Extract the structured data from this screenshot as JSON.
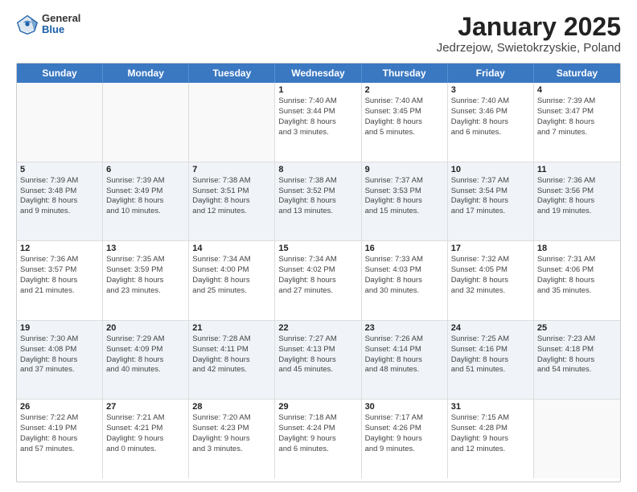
{
  "header": {
    "logo_general": "General",
    "logo_blue": "Blue",
    "title": "January 2025",
    "subtitle": "Jedrzejow, Swietokrzyskie, Poland"
  },
  "weekdays": [
    "Sunday",
    "Monday",
    "Tuesday",
    "Wednesday",
    "Thursday",
    "Friday",
    "Saturday"
  ],
  "rows": [
    {
      "alt": false,
      "cells": [
        {
          "day": "",
          "lines": []
        },
        {
          "day": "",
          "lines": []
        },
        {
          "day": "",
          "lines": []
        },
        {
          "day": "1",
          "lines": [
            "Sunrise: 7:40 AM",
            "Sunset: 3:44 PM",
            "Daylight: 8 hours",
            "and 3 minutes."
          ]
        },
        {
          "day": "2",
          "lines": [
            "Sunrise: 7:40 AM",
            "Sunset: 3:45 PM",
            "Daylight: 8 hours",
            "and 5 minutes."
          ]
        },
        {
          "day": "3",
          "lines": [
            "Sunrise: 7:40 AM",
            "Sunset: 3:46 PM",
            "Daylight: 8 hours",
            "and 6 minutes."
          ]
        },
        {
          "day": "4",
          "lines": [
            "Sunrise: 7:39 AM",
            "Sunset: 3:47 PM",
            "Daylight: 8 hours",
            "and 7 minutes."
          ]
        }
      ]
    },
    {
      "alt": true,
      "cells": [
        {
          "day": "5",
          "lines": [
            "Sunrise: 7:39 AM",
            "Sunset: 3:48 PM",
            "Daylight: 8 hours",
            "and 9 minutes."
          ]
        },
        {
          "day": "6",
          "lines": [
            "Sunrise: 7:39 AM",
            "Sunset: 3:49 PM",
            "Daylight: 8 hours",
            "and 10 minutes."
          ]
        },
        {
          "day": "7",
          "lines": [
            "Sunrise: 7:38 AM",
            "Sunset: 3:51 PM",
            "Daylight: 8 hours",
            "and 12 minutes."
          ]
        },
        {
          "day": "8",
          "lines": [
            "Sunrise: 7:38 AM",
            "Sunset: 3:52 PM",
            "Daylight: 8 hours",
            "and 13 minutes."
          ]
        },
        {
          "day": "9",
          "lines": [
            "Sunrise: 7:37 AM",
            "Sunset: 3:53 PM",
            "Daylight: 8 hours",
            "and 15 minutes."
          ]
        },
        {
          "day": "10",
          "lines": [
            "Sunrise: 7:37 AM",
            "Sunset: 3:54 PM",
            "Daylight: 8 hours",
            "and 17 minutes."
          ]
        },
        {
          "day": "11",
          "lines": [
            "Sunrise: 7:36 AM",
            "Sunset: 3:56 PM",
            "Daylight: 8 hours",
            "and 19 minutes."
          ]
        }
      ]
    },
    {
      "alt": false,
      "cells": [
        {
          "day": "12",
          "lines": [
            "Sunrise: 7:36 AM",
            "Sunset: 3:57 PM",
            "Daylight: 8 hours",
            "and 21 minutes."
          ]
        },
        {
          "day": "13",
          "lines": [
            "Sunrise: 7:35 AM",
            "Sunset: 3:59 PM",
            "Daylight: 8 hours",
            "and 23 minutes."
          ]
        },
        {
          "day": "14",
          "lines": [
            "Sunrise: 7:34 AM",
            "Sunset: 4:00 PM",
            "Daylight: 8 hours",
            "and 25 minutes."
          ]
        },
        {
          "day": "15",
          "lines": [
            "Sunrise: 7:34 AM",
            "Sunset: 4:02 PM",
            "Daylight: 8 hours",
            "and 27 minutes."
          ]
        },
        {
          "day": "16",
          "lines": [
            "Sunrise: 7:33 AM",
            "Sunset: 4:03 PM",
            "Daylight: 8 hours",
            "and 30 minutes."
          ]
        },
        {
          "day": "17",
          "lines": [
            "Sunrise: 7:32 AM",
            "Sunset: 4:05 PM",
            "Daylight: 8 hours",
            "and 32 minutes."
          ]
        },
        {
          "day": "18",
          "lines": [
            "Sunrise: 7:31 AM",
            "Sunset: 4:06 PM",
            "Daylight: 8 hours",
            "and 35 minutes."
          ]
        }
      ]
    },
    {
      "alt": true,
      "cells": [
        {
          "day": "19",
          "lines": [
            "Sunrise: 7:30 AM",
            "Sunset: 4:08 PM",
            "Daylight: 8 hours",
            "and 37 minutes."
          ]
        },
        {
          "day": "20",
          "lines": [
            "Sunrise: 7:29 AM",
            "Sunset: 4:09 PM",
            "Daylight: 8 hours",
            "and 40 minutes."
          ]
        },
        {
          "day": "21",
          "lines": [
            "Sunrise: 7:28 AM",
            "Sunset: 4:11 PM",
            "Daylight: 8 hours",
            "and 42 minutes."
          ]
        },
        {
          "day": "22",
          "lines": [
            "Sunrise: 7:27 AM",
            "Sunset: 4:13 PM",
            "Daylight: 8 hours",
            "and 45 minutes."
          ]
        },
        {
          "day": "23",
          "lines": [
            "Sunrise: 7:26 AM",
            "Sunset: 4:14 PM",
            "Daylight: 8 hours",
            "and 48 minutes."
          ]
        },
        {
          "day": "24",
          "lines": [
            "Sunrise: 7:25 AM",
            "Sunset: 4:16 PM",
            "Daylight: 8 hours",
            "and 51 minutes."
          ]
        },
        {
          "day": "25",
          "lines": [
            "Sunrise: 7:23 AM",
            "Sunset: 4:18 PM",
            "Daylight: 8 hours",
            "and 54 minutes."
          ]
        }
      ]
    },
    {
      "alt": false,
      "cells": [
        {
          "day": "26",
          "lines": [
            "Sunrise: 7:22 AM",
            "Sunset: 4:19 PM",
            "Daylight: 8 hours",
            "and 57 minutes."
          ]
        },
        {
          "day": "27",
          "lines": [
            "Sunrise: 7:21 AM",
            "Sunset: 4:21 PM",
            "Daylight: 9 hours",
            "and 0 minutes."
          ]
        },
        {
          "day": "28",
          "lines": [
            "Sunrise: 7:20 AM",
            "Sunset: 4:23 PM",
            "Daylight: 9 hours",
            "and 3 minutes."
          ]
        },
        {
          "day": "29",
          "lines": [
            "Sunrise: 7:18 AM",
            "Sunset: 4:24 PM",
            "Daylight: 9 hours",
            "and 6 minutes."
          ]
        },
        {
          "day": "30",
          "lines": [
            "Sunrise: 7:17 AM",
            "Sunset: 4:26 PM",
            "Daylight: 9 hours",
            "and 9 minutes."
          ]
        },
        {
          "day": "31",
          "lines": [
            "Sunrise: 7:15 AM",
            "Sunset: 4:28 PM",
            "Daylight: 9 hours",
            "and 12 minutes."
          ]
        },
        {
          "day": "",
          "lines": []
        }
      ]
    }
  ]
}
